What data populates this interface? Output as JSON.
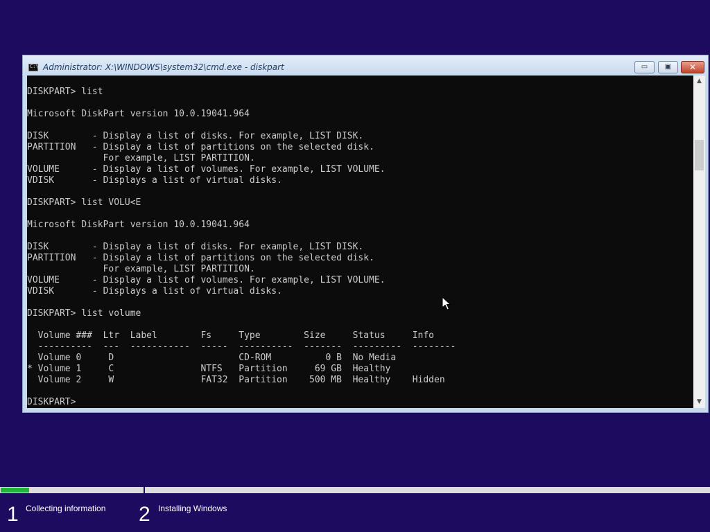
{
  "window": {
    "title": "Administrator: X:\\WINDOWS\\system32\\cmd.exe - diskpart",
    "icon_label": "C:\\",
    "buttons": {
      "minimize_icon": "minimize-icon",
      "maximize_icon": "maximize-icon",
      "close_icon": "close-icon",
      "minimize_glyph": "▭",
      "maximize_glyph": "▣",
      "close_glyph": "✕"
    }
  },
  "console": {
    "lines": [
      "",
      "DISKPART> list",
      "",
      "Microsoft DiskPart version 10.0.19041.964",
      "",
      "DISK        - Display a list of disks. For example, LIST DISK.",
      "PARTITION   - Display a list of partitions on the selected disk.",
      "              For example, LIST PARTITION.",
      "VOLUME      - Display a list of volumes. For example, LIST VOLUME.",
      "VDISK       - Displays a list of virtual disks.",
      "",
      "DISKPART> list VOLU<E",
      "",
      "Microsoft DiskPart version 10.0.19041.964",
      "",
      "DISK        - Display a list of disks. For example, LIST DISK.",
      "PARTITION   - Display a list of partitions on the selected disk.",
      "              For example, LIST PARTITION.",
      "VOLUME      - Display a list of volumes. For example, LIST VOLUME.",
      "VDISK       - Displays a list of virtual disks.",
      "",
      "DISKPART> list volume",
      "",
      "  Volume ###  Ltr  Label        Fs     Type        Size     Status     Info",
      "  ----------  ---  -----------  -----  ----------  -------  ---------  --------",
      "  Volume 0     D                       CD-ROM          0 B  No Media",
      "* Volume 1     C                NTFS   Partition     69 GB  Healthy",
      "  Volume 2     W                FAT32  Partition    500 MB  Healthy    Hidden",
      "",
      "DISKPART> "
    ]
  },
  "scrollbar": {
    "up_glyph": "▲",
    "down_glyph": "▼"
  },
  "setup": {
    "progress_fraction": 0.2,
    "steps": [
      {
        "number": "1",
        "label": "Collecting information"
      },
      {
        "number": "2",
        "label": "Installing Windows"
      }
    ]
  },
  "colors": {
    "desktop_background": "#1c0b5e",
    "console_background": "#0c0c0c",
    "console_text": "#cccccc",
    "progress_fill": "#1fb53a"
  }
}
